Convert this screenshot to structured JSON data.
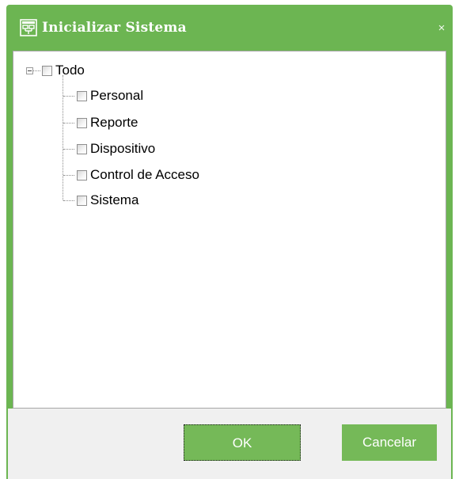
{
  "dialog": {
    "title": "Inicializar Sistema",
    "close_label": "×",
    "title_icon": "system-tree-icon",
    "accent_color": "#6cb552"
  },
  "tree": {
    "root": {
      "label": "Todo",
      "expanded": true,
      "checked": false
    },
    "children": [
      {
        "label": "Personal",
        "checked": false
      },
      {
        "label": "Reporte",
        "checked": false
      },
      {
        "label": "Dispositivo",
        "checked": false
      },
      {
        "label": "Control de Acceso",
        "checked": false
      },
      {
        "label": "Sistema",
        "checked": false
      }
    ]
  },
  "buttons": {
    "ok_label": "OK",
    "cancel_label": "Cancelar"
  }
}
